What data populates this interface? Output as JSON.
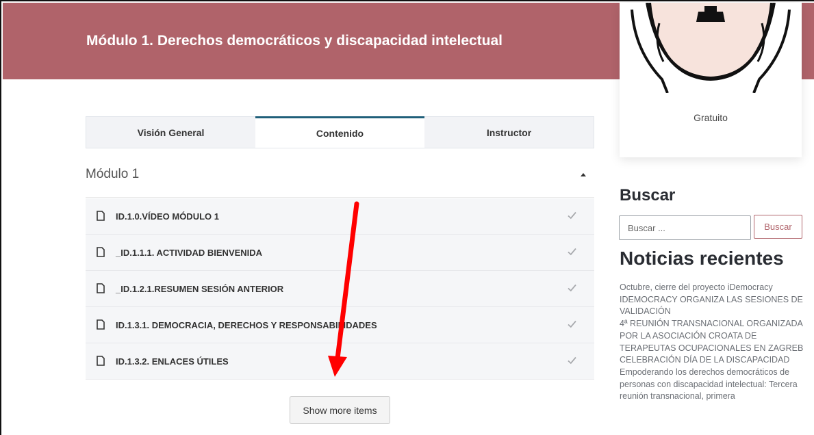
{
  "hero": {
    "title": "Módulo 1. Derechos democráticos y discapacidad intelectual"
  },
  "sidebar": {
    "price": "Gratuito",
    "search": {
      "heading": "Buscar",
      "placeholder": "Buscar ...",
      "button": "Buscar"
    },
    "news": {
      "heading": "Noticias recientes",
      "items": [
        "Octubre, cierre del proyecto iDemocracy",
        "IDEMOCRACY ORGANIZA LAS SESIONES DE VALIDACIÓN",
        "4ª REUNIÓN TRANSNACIONAL ORGANIZADA POR LA ASOCIACIÓN CROATA DE TERAPEUTAS OCUPACIONALES EN ZAGREB",
        "CELEBRACIÓN DÍA DE LA DISCAPACIDAD",
        "Empoderando los derechos democráticos de personas con discapacidad intelectual: Tercera reunión transnacional, primera"
      ]
    }
  },
  "tabs": [
    {
      "label": "Visión General",
      "active": false
    },
    {
      "label": "Contenido",
      "active": true
    },
    {
      "label": "Instructor",
      "active": false
    }
  ],
  "section": {
    "title": "Módulo 1",
    "lessons": [
      {
        "label": "ID.1.0.VÍDEO MÓDULO 1",
        "completed": true
      },
      {
        "label": "_ID.1.1.1. ACTIVIDAD BIENVENIDA",
        "completed": true
      },
      {
        "label": "_ID.1.2.1.RESUMEN SESIÓN ANTERIOR",
        "completed": true
      },
      {
        "label": "ID.1.3.1. DEMOCRACIA, DERECHOS Y RESPONSABILIDADES",
        "completed": true
      },
      {
        "label": "ID.1.3.2. ENLACES ÚTILES",
        "completed": true
      }
    ],
    "show_more": "Show more items"
  },
  "colors": {
    "brand": "#b0636a",
    "tab_accent": "#1f5f7a",
    "annotation_arrow": "#ff0000"
  }
}
